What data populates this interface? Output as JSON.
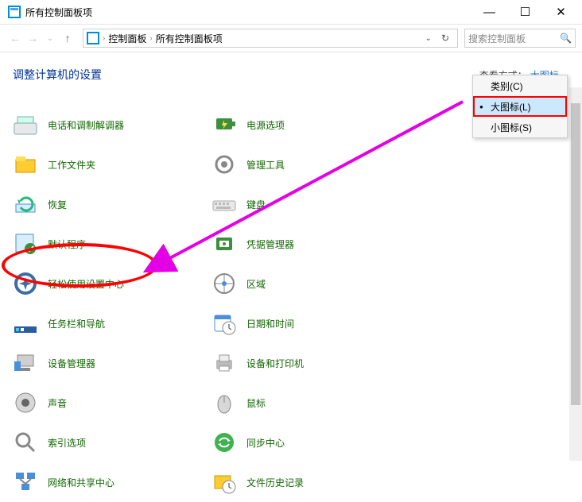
{
  "window": {
    "title": "所有控制面板项"
  },
  "address": {
    "root": "控制面板",
    "current": "所有控制面板项"
  },
  "search": {
    "placeholder": "搜索控制面板"
  },
  "heading": {
    "title": "调整计算机的设置",
    "viewByLabel": "查看方式：",
    "viewBySelected": "大图标"
  },
  "dropdown": {
    "items": [
      {
        "label": "类别(C)",
        "selected": false
      },
      {
        "label": "大图标(L)",
        "selected": true
      },
      {
        "label": "小图标(S)",
        "selected": false
      }
    ]
  },
  "items": {
    "col1": [
      {
        "id": "phone-modem",
        "label": "电话和调制解调器"
      },
      {
        "id": "work-folders",
        "label": "工作文件夹"
      },
      {
        "id": "recovery",
        "label": "恢复"
      },
      {
        "id": "default-programs",
        "label": "默认程序"
      },
      {
        "id": "ease-of-access",
        "label": "轻松使用设置中心"
      },
      {
        "id": "taskbar-nav",
        "label": "任务栏和导航"
      },
      {
        "id": "device-manager",
        "label": "设备管理器"
      },
      {
        "id": "sound",
        "label": "声音"
      },
      {
        "id": "indexing",
        "label": "索引选项"
      },
      {
        "id": "network-sharing",
        "label": "网络和共享中心"
      }
    ],
    "col2": [
      {
        "id": "power",
        "label": "电源选项"
      },
      {
        "id": "admin-tools",
        "label": "管理工具"
      },
      {
        "id": "keyboard",
        "label": "键盘"
      },
      {
        "id": "credential-manager",
        "label": "凭据管理器"
      },
      {
        "id": "region",
        "label": "区域"
      },
      {
        "id": "date-time",
        "label": "日期和时间"
      },
      {
        "id": "devices-printers",
        "label": "设备和打印机"
      },
      {
        "id": "mouse",
        "label": "鼠标"
      },
      {
        "id": "sync-center",
        "label": "同步中心"
      },
      {
        "id": "file-history",
        "label": "文件历史记录"
      }
    ]
  }
}
